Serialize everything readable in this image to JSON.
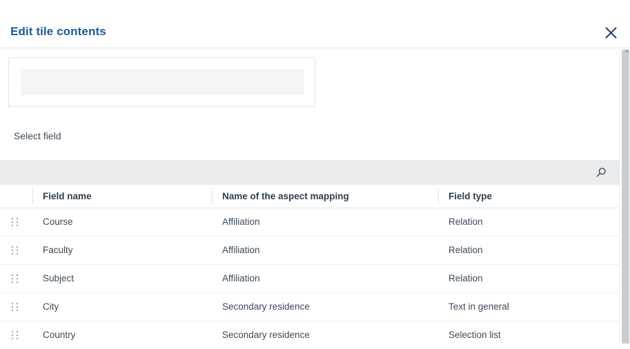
{
  "dialog": {
    "title": "Edit tile contents",
    "close_label": "Close",
    "close_icon": "close-icon"
  },
  "tile_preview": {
    "content": ""
  },
  "section": {
    "label": "Select field"
  },
  "search": {
    "value": "",
    "placeholder": "",
    "icon": "search-icon"
  },
  "table": {
    "columns": [
      {
        "key": "drag",
        "label": ""
      },
      {
        "key": "field_name",
        "label": "Field name"
      },
      {
        "key": "aspect_mapping",
        "label": "Name of the aspect mapping"
      },
      {
        "key": "field_type",
        "label": "Field type"
      }
    ],
    "rows": [
      {
        "drag_icon": "drag-handle-icon",
        "field_name": "Course",
        "aspect_mapping": "Affiliation",
        "field_type": "Relation"
      },
      {
        "drag_icon": "drag-handle-icon",
        "field_name": "Faculty",
        "aspect_mapping": "Affiliation",
        "field_type": "Relation"
      },
      {
        "drag_icon": "drag-handle-icon",
        "field_name": "Subject",
        "aspect_mapping": "Affiliation",
        "field_type": "Relation"
      },
      {
        "drag_icon": "drag-handle-icon",
        "field_name": "City",
        "aspect_mapping": "Secondary residence",
        "field_type": "Text in general"
      },
      {
        "drag_icon": "drag-handle-icon",
        "field_name": "Country",
        "aspect_mapping": "Secondary residence",
        "field_type": "Selection list"
      }
    ]
  },
  "colors": {
    "title": "#1b5a9e",
    "text": "#3c4a58",
    "strip_bg": "#eaecee",
    "skeleton": "#f2f4f6",
    "border": "#e3e6e9",
    "scrollbar_thumb": "#c9ccd1"
  },
  "scrollbar": {
    "orientation": "vertical"
  }
}
